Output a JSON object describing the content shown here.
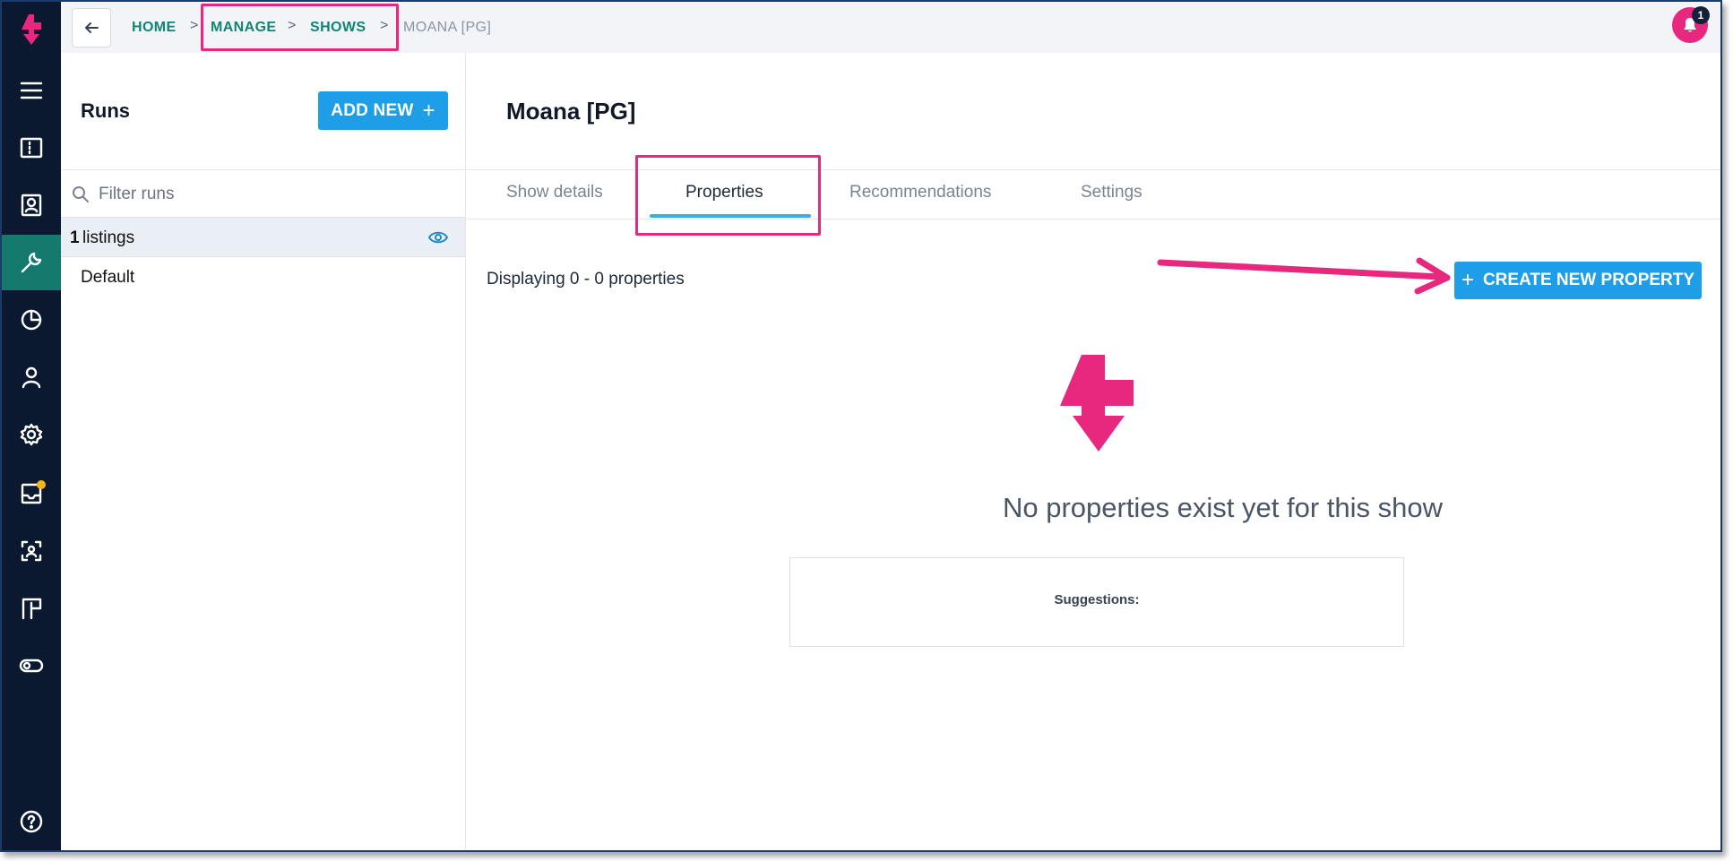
{
  "breadcrumb": {
    "home": "HOME",
    "manage": "MANAGE",
    "shows": "SHOWS",
    "current": "MOANA [PG]",
    "separator": ">"
  },
  "notifications": {
    "count": "1"
  },
  "runs": {
    "title": "Runs",
    "add_new_label": "ADD NEW",
    "add_icon": "+",
    "filter_placeholder": "Filter runs",
    "listing_count": "1",
    "listing_label": "listings",
    "items": [
      "Default"
    ]
  },
  "show": {
    "title": "Moana [PG]"
  },
  "tabs": [
    {
      "label": "Show details",
      "active": false
    },
    {
      "label": "Properties",
      "active": true
    },
    {
      "label": "Recommendations",
      "active": false
    },
    {
      "label": "Settings",
      "active": false
    }
  ],
  "properties": {
    "displaying_text": "Displaying 0 - 0 properties",
    "create_label": "CREATE NEW PROPERTY",
    "create_icon": "+",
    "empty_message": "No properties exist yet for this show",
    "suggestions_label": "Suggestions:"
  },
  "colors": {
    "brand_pink": "#e8277e",
    "primary_blue": "#1e9ee6",
    "rail_bg": "#0b1930",
    "rail_active": "#147a6e",
    "link_teal": "#128474"
  },
  "icons": {
    "rail": [
      "logo-icon",
      "menu-icon",
      "ticket-icon",
      "contact-icon",
      "tools-icon",
      "pie-chart-icon",
      "user-icon",
      "settings-icon",
      "inbox-icon",
      "scan-face-icon",
      "layout-icon",
      "toggle-icon",
      "help-icon"
    ]
  }
}
